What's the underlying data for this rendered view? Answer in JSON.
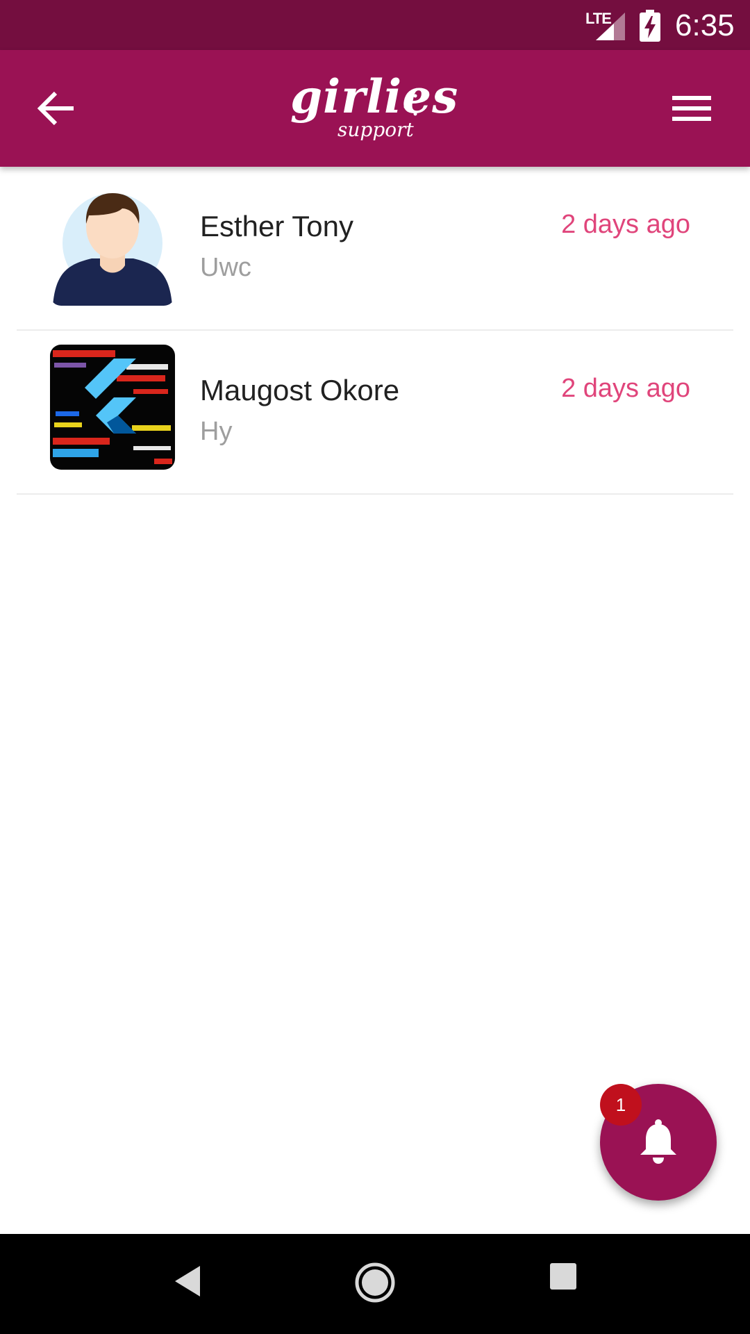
{
  "status_bar": {
    "network": "LTE",
    "time": "6:35",
    "icons": [
      "signal-icon",
      "battery-charging-icon"
    ]
  },
  "app_bar": {
    "logo_main": "girlies",
    "logo_sub": "support",
    "icons": [
      "back-arrow-icon",
      "hamburger-menu-icon"
    ],
    "color": "#9a1254"
  },
  "conversations": [
    {
      "name": "Esther Tony",
      "last_message": "Uwc",
      "time": "2 days ago",
      "avatar": "default-person-avatar"
    },
    {
      "name": "Maugost Okore",
      "last_message": "Hy",
      "time": "2 days ago",
      "avatar": "flutter-code-avatar"
    }
  ],
  "fab": {
    "icon": "bell-icon",
    "badge_count": "1"
  },
  "nav_bar": {
    "icons": [
      "nav-back-icon",
      "nav-home-icon",
      "nav-recents-icon"
    ]
  },
  "colors": {
    "status_bar": "#740e3f",
    "accent": "#9a1254",
    "timestamp": "#e0457b",
    "badge": "#c0101d"
  }
}
